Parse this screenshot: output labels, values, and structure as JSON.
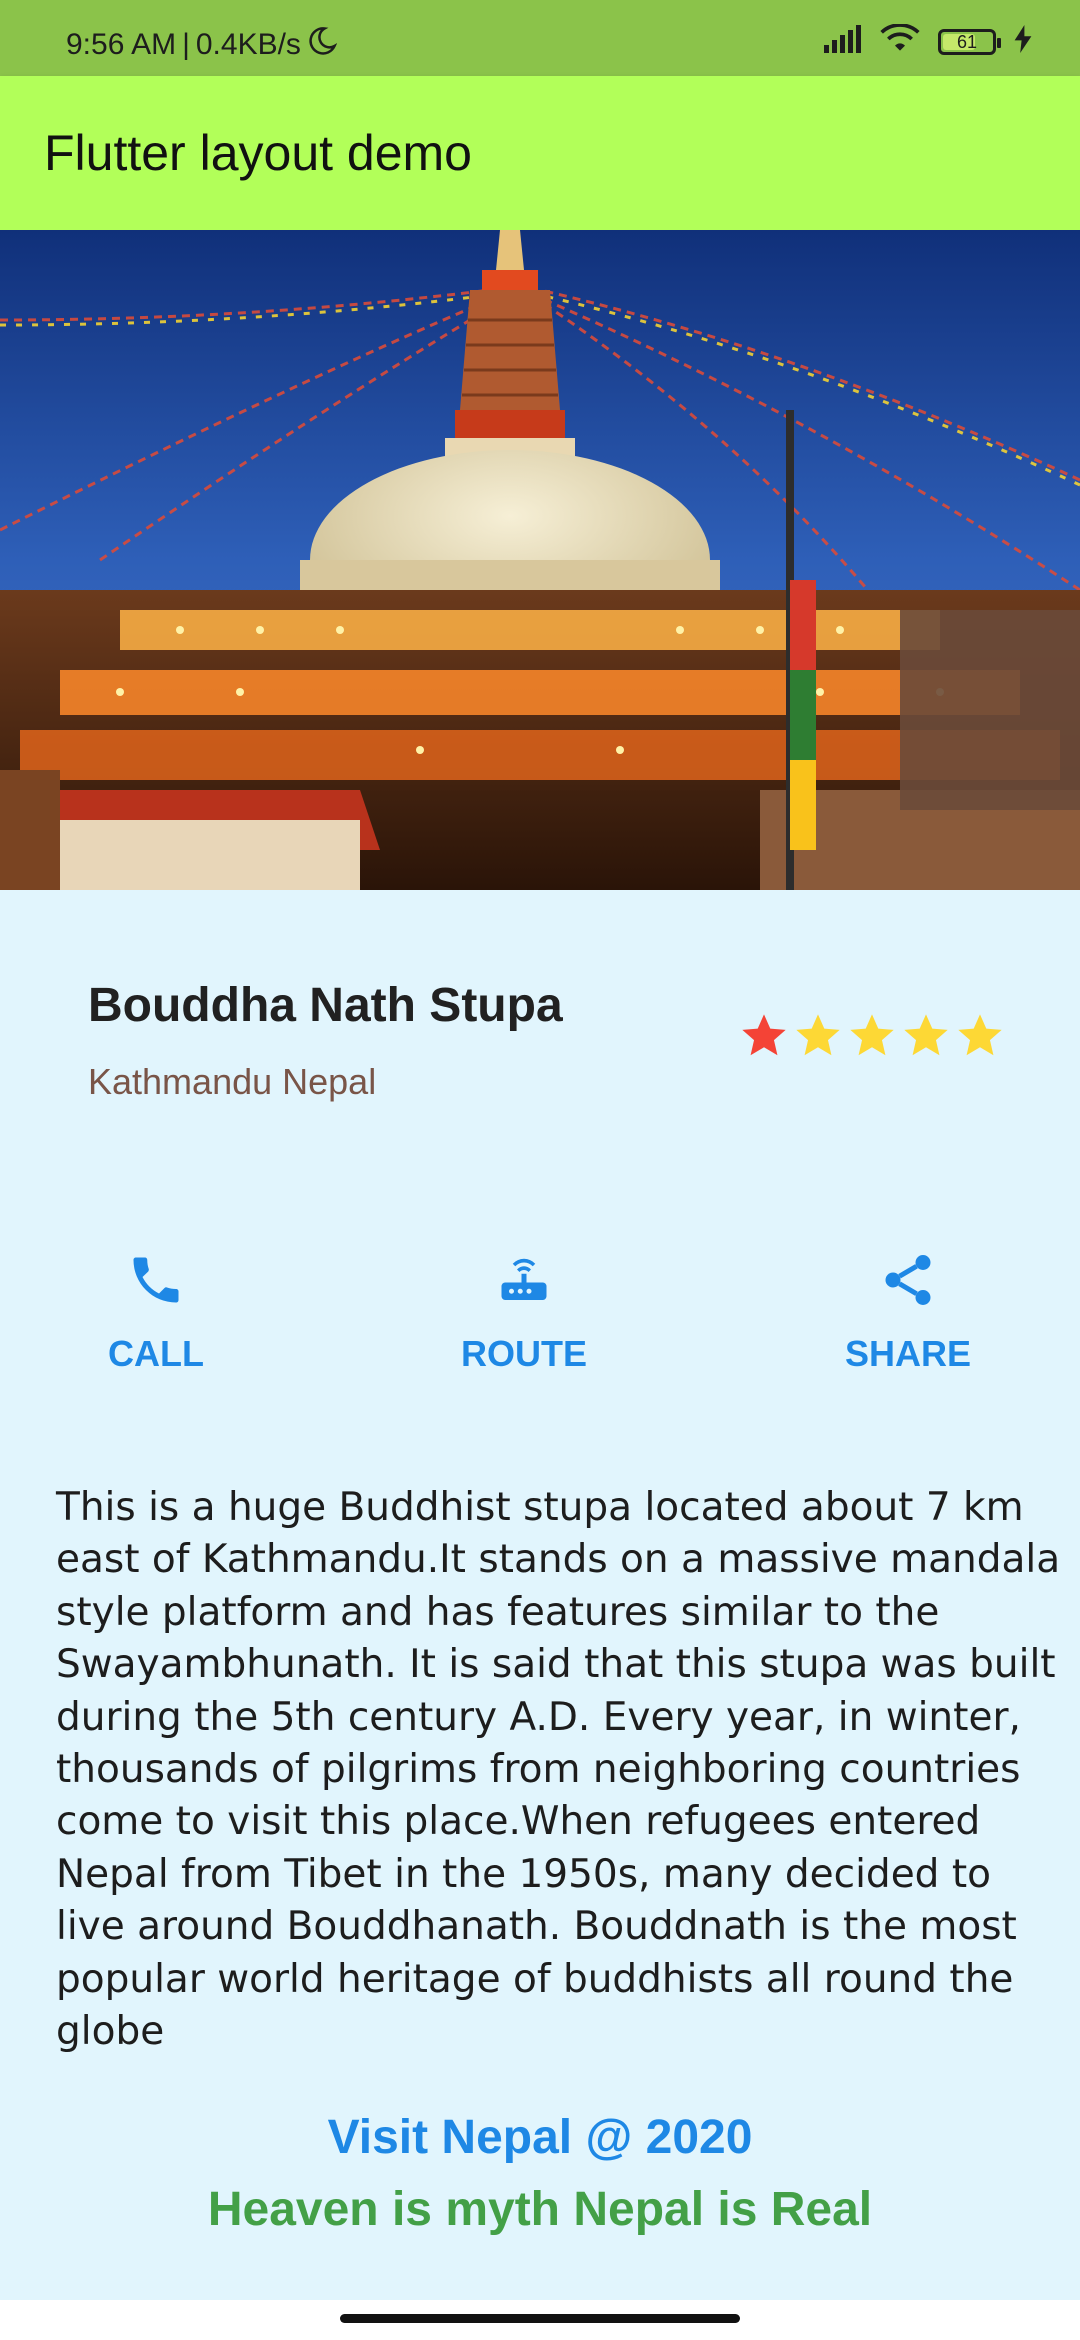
{
  "status_bar": {
    "time": "9:56 AM",
    "separator": "|",
    "net_speed": "0.4KB/s",
    "battery_level": "61",
    "icons": [
      "moon-icon",
      "signal-icon",
      "wifi-icon",
      "battery-icon",
      "charging-icon"
    ]
  },
  "app_bar": {
    "title": "Flutter layout demo"
  },
  "place": {
    "title": "Bouddha Nath Stupa",
    "location": "Kathmandu Nepal",
    "rating": {
      "stars": 5,
      "first_star_color": "#f44336",
      "other_star_color": "#fdd835"
    }
  },
  "actions": [
    {
      "label": "CALL",
      "icon": "phone-icon"
    },
    {
      "label": "ROUTE",
      "icon": "router-icon"
    },
    {
      "label": "SHARE",
      "icon": "share-icon"
    }
  ],
  "description": "This is a huge Buddhist stupa located about 7 km east of Kathmandu.It stands on a massive mandala style platform and has features similar to the Swayambhunath. It is said that this stupa was built during the 5th century A.D. Every year, in winter, thousands of pilgrims from neighboring countries come to visit this place.When refugees entered Nepal from Tibet in the 1950s, many decided to live around Bouddhanath. Bouddnath is the most popular world heritage of buddhists all round the globe",
  "footer": {
    "line1": "Visit Nepal @ 2020",
    "line2": "Heaven is myth Nepal is Real"
  },
  "colors": {
    "status_bar": "#8bc34a",
    "app_bar": "#b2ff59",
    "background": "#e1f5fd",
    "accent_blue": "#1e88e5",
    "location_brown": "#795548",
    "footer_green": "#43a047"
  }
}
